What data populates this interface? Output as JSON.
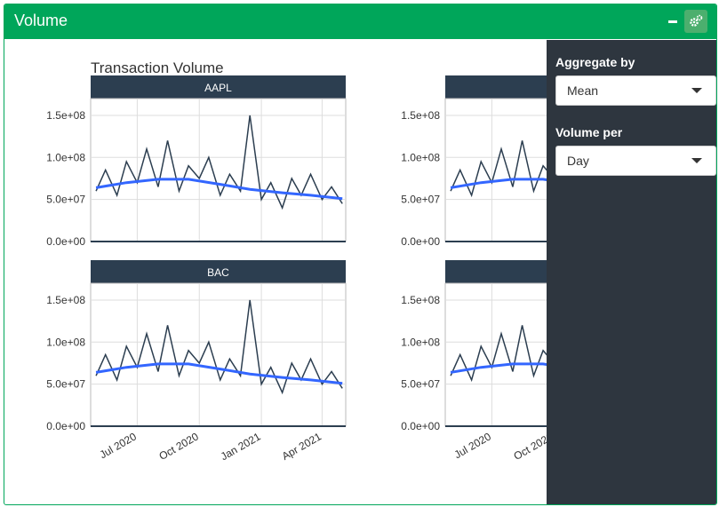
{
  "box": {
    "title": "Volume"
  },
  "header_icons": {
    "collapse": "minus-icon",
    "options": "gears-icon"
  },
  "sidebar": {
    "aggregate_label": "Aggregate by",
    "aggregate_value": "Mean",
    "volume_per_label": "Volume per",
    "volume_per_value": "Day"
  },
  "colors": {
    "header": "#00a65a",
    "sidebar": "#2e363f",
    "strip": "#2c3e50",
    "line": "#2c3e50",
    "smooth": "#3366ff"
  },
  "chart_data": {
    "type": "line",
    "title": "Transaction Volume",
    "x_ticks": [
      "Jul 2020",
      "Oct 2020",
      "Jan 2021",
      "Apr 2021"
    ],
    "y_ticks": [
      "0.0e+00",
      "5.0e+07",
      "1.0e+08",
      "1.5e+08"
    ],
    "ylim": [
      0,
      170000000
    ],
    "x_range": [
      "2020-04-23",
      "2021-05-06"
    ],
    "grid": true,
    "panels": [
      {
        "label": "AAPL"
      },
      {
        "label": ""
      },
      {
        "label": "BAC"
      },
      {
        "label": ""
      }
    ],
    "series": [
      {
        "x": [
          "2020-05-01",
          "2020-05-15",
          "2020-06-01",
          "2020-06-15",
          "2020-07-01",
          "2020-07-15",
          "2020-08-01",
          "2020-08-15",
          "2020-09-01",
          "2020-09-15",
          "2020-10-01",
          "2020-10-15",
          "2020-11-01",
          "2020-11-15",
          "2020-12-01",
          "2020-12-15",
          "2021-01-01",
          "2021-01-15",
          "2021-02-01",
          "2021-02-15",
          "2021-03-01",
          "2021-03-15",
          "2021-04-01",
          "2021-04-15",
          "2021-05-01"
        ],
        "values": [
          60000000,
          85000000,
          55000000,
          95000000,
          70000000,
          110000000,
          65000000,
          120000000,
          60000000,
          90000000,
          75000000,
          100000000,
          55000000,
          80000000,
          60000000,
          150000000,
          50000000,
          70000000,
          40000000,
          75000000,
          55000000,
          80000000,
          50000000,
          65000000,
          45000000
        ]
      },
      {
        "name": "smooth",
        "x": [
          "2020-05-01",
          "2020-06-15",
          "2020-08-01",
          "2020-09-15",
          "2020-11-01",
          "2020-12-15",
          "2021-02-01",
          "2021-03-15",
          "2021-05-01"
        ],
        "values": [
          64000000,
          70000000,
          74000000,
          74000000,
          68000000,
          62000000,
          58000000,
          55000000,
          51000000
        ]
      }
    ]
  }
}
